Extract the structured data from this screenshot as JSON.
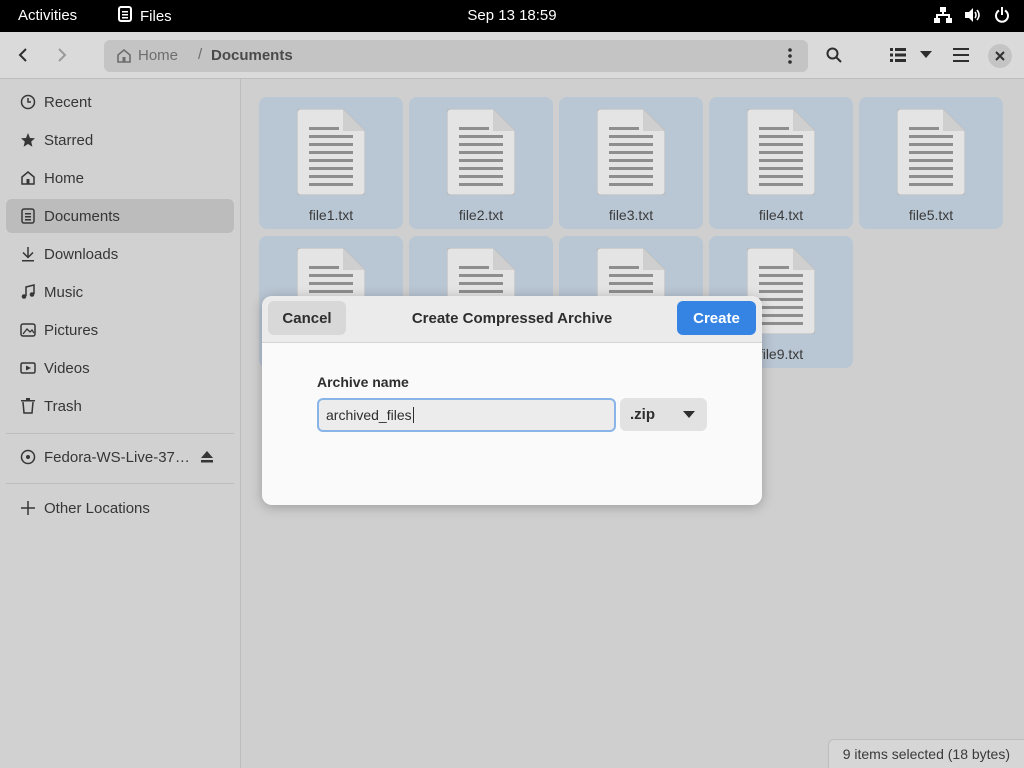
{
  "topbar": {
    "activities": "Activities",
    "app_name": "Files",
    "clock": "Sep 13  18:59"
  },
  "header": {
    "path_home": "Home",
    "path_separator": "/",
    "path_current": "Documents"
  },
  "sidebar": {
    "items": [
      {
        "label": "Recent",
        "icon": "clock-icon"
      },
      {
        "label": "Starred",
        "icon": "star-icon"
      },
      {
        "label": "Home",
        "icon": "home-icon"
      },
      {
        "label": "Documents",
        "icon": "document-icon",
        "active": true
      },
      {
        "label": "Downloads",
        "icon": "download-icon"
      },
      {
        "label": "Music",
        "icon": "music-icon"
      },
      {
        "label": "Pictures",
        "icon": "picture-icon"
      },
      {
        "label": "Videos",
        "icon": "video-icon"
      },
      {
        "label": "Trash",
        "icon": "trash-icon"
      }
    ],
    "drive": "Fedora-WS-Live-37…",
    "other_locations": "Other Locations"
  },
  "files": [
    {
      "name": "file1.txt"
    },
    {
      "name": "file2.txt"
    },
    {
      "name": "file3.txt"
    },
    {
      "name": "file4.txt"
    },
    {
      "name": "file5.txt"
    },
    {
      "name": ""
    },
    {
      "name": ""
    },
    {
      "name": ""
    },
    {
      "name": "file9.txt"
    }
  ],
  "status": "9 items selected (18 bytes)",
  "dialog": {
    "title": "Create Compressed Archive",
    "cancel": "Cancel",
    "create": "Create",
    "field_label": "Archive name",
    "field_value": "archived_files",
    "format": ".zip"
  },
  "colors": {
    "accent": "#3584e4",
    "selection": "#b9c6d3"
  }
}
